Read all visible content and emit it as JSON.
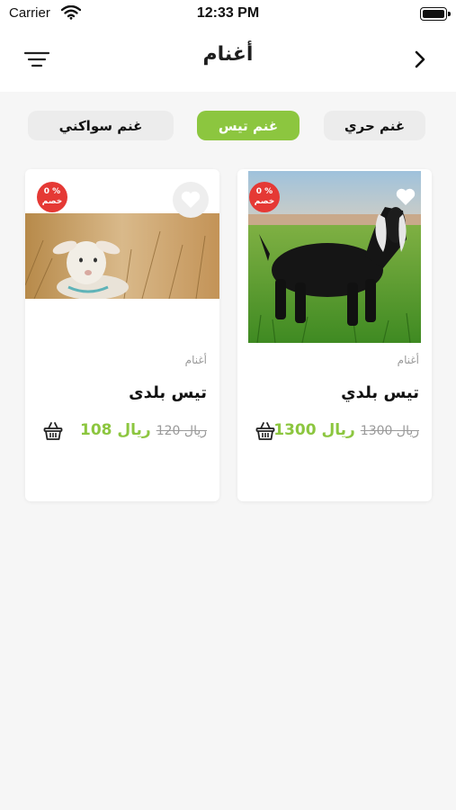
{
  "status_bar": {
    "carrier": "Carrier",
    "time": "12:33 PM"
  },
  "header": {
    "title": "أغنام"
  },
  "categories": [
    {
      "label": "غنم حري",
      "active": false
    },
    {
      "label": "غنم تيس",
      "active": true
    },
    {
      "label": "غنم سواكني",
      "active": false
    }
  ],
  "products": [
    {
      "discount_value": "0 %",
      "discount_label": "خصم",
      "category": "أغنام",
      "name": "تيس بلدي",
      "price_new": "1300 ريال",
      "price_old": "1300 ريال",
      "image": "goat-photo"
    },
    {
      "discount_value": "0 %",
      "discount_label": "خصم",
      "category": "أغنام",
      "name": "تيس بلدى",
      "price_new": "108 ريال",
      "price_old": "120 ريال",
      "image": "lamb-photo"
    }
  ],
  "colors": {
    "accent": "#8cc63f",
    "discount": "#e53935",
    "chip_bg": "#ececec"
  }
}
